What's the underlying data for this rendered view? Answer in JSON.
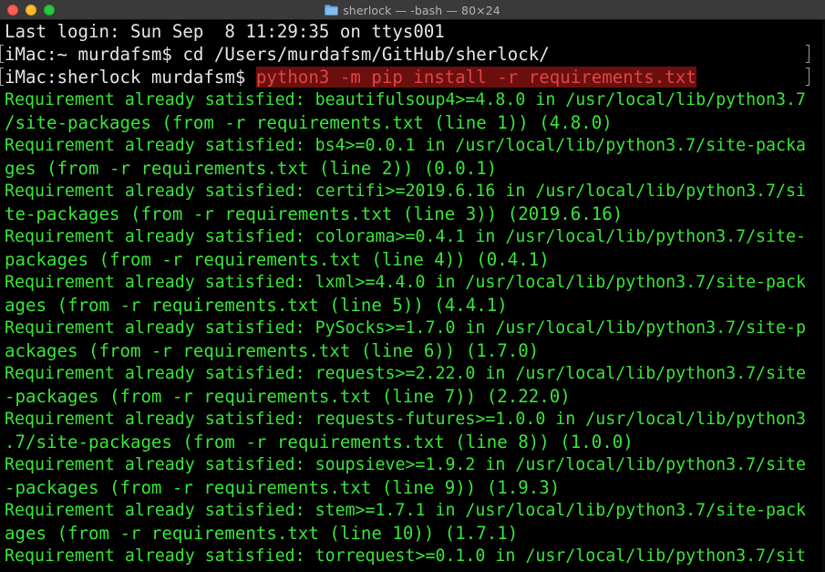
{
  "window": {
    "title": "sherlock — -bash — 80×24",
    "folder_icon": "folder-icon",
    "buttons": [
      "close",
      "minimize",
      "maximize"
    ],
    "colors": {
      "background": "#000000",
      "text_white": "#e6e6e6",
      "text_green": "#39e639",
      "highlight_bg": "#6b0f0f",
      "highlight_fg": "#e04545",
      "titlebar": "#3a3a3a"
    }
  },
  "terminal": {
    "last_login": "Last login: Sun Sep  8 11:29:35 on ttys001",
    "prompt1": "iMac:~ murdafsm$ ",
    "cmd1": "cd /Users/murdafsm/GitHub/sherlock/",
    "prompt2": "iMac:sherlock murdafsm$ ",
    "cmd2": "python3 -m pip install -r requirements.txt",
    "output": [
      "Requirement already satisfied: beautifulsoup4>=4.8.0 in /usr/local/lib/python3.7",
      "/site-packages (from -r requirements.txt (line 1)) (4.8.0)",
      "Requirement already satisfied: bs4>=0.0.1 in /usr/local/lib/python3.7/site-packa",
      "ges (from -r requirements.txt (line 2)) (0.0.1)",
      "Requirement already satisfied: certifi>=2019.6.16 in /usr/local/lib/python3.7/si",
      "te-packages (from -r requirements.txt (line 3)) (2019.6.16)",
      "Requirement already satisfied: colorama>=0.4.1 in /usr/local/lib/python3.7/site-",
      "packages (from -r requirements.txt (line 4)) (0.4.1)",
      "Requirement already satisfied: lxml>=4.4.0 in /usr/local/lib/python3.7/site-pack",
      "ages (from -r requirements.txt (line 5)) (4.4.1)",
      "Requirement already satisfied: PySocks>=1.7.0 in /usr/local/lib/python3.7/site-p",
      "ackages (from -r requirements.txt (line 6)) (1.7.0)",
      "Requirement already satisfied: requests>=2.22.0 in /usr/local/lib/python3.7/site",
      "-packages (from -r requirements.txt (line 7)) (2.22.0)",
      "Requirement already satisfied: requests-futures>=1.0.0 in /usr/local/lib/python3",
      ".7/site-packages (from -r requirements.txt (line 8)) (1.0.0)",
      "Requirement already satisfied: soupsieve>=1.9.2 in /usr/local/lib/python3.7/site",
      "-packages (from -r requirements.txt (line 9)) (1.9.3)",
      "Requirement already satisfied: stem>=1.7.1 in /usr/local/lib/python3.7/site-pack",
      "ages (from -r requirements.txt (line 10)) (1.7.1)",
      "Requirement already satisfied: torrequest>=0.1.0 in /usr/local/lib/python3.7/sit"
    ]
  }
}
